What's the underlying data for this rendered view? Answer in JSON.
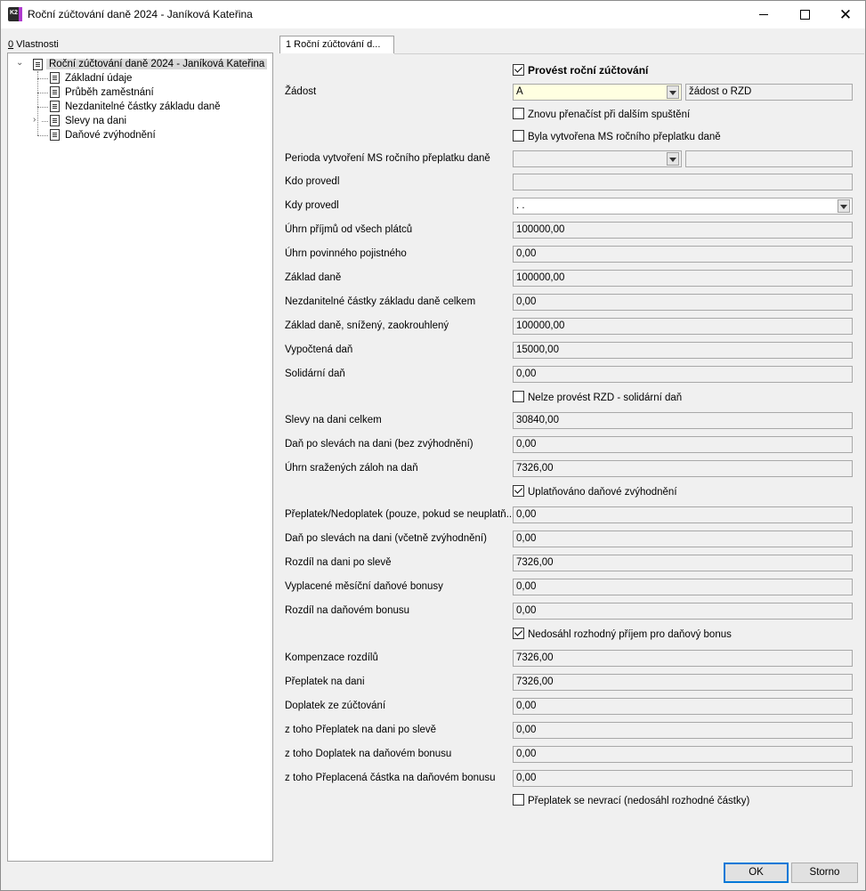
{
  "window": {
    "title": "Roční zúčtování daně 2024 - Janíková Kateřina",
    "icon_text": "K2"
  },
  "tree": {
    "header_prefix": "0",
    "header_rest": " Vlastnosti",
    "root": "Roční zúčtování daně 2024 - Janíková Kateřina",
    "items": [
      "Základní údaje",
      "Průběh zaměstnání",
      "Nezdanitelné částky základu daně",
      "Slevy na dani",
      "Daňové zvýhodnění"
    ]
  },
  "tab": {
    "label": "1 Roční zúčtování d..."
  },
  "form": {
    "chk_provest": "Provést roční zúčtování",
    "zadost_label": "Žádost",
    "zadost_value": "A",
    "zadost_desc": "žádost o RZD",
    "chk_znovu": "Znovu přenačíst při dalším spuštění",
    "chk_byla": "Byla vytvořena MS ročního přeplatku daně",
    "perioda_label": "Perioda vytvoření MS ročního přeplatku daně",
    "kdo_label": "Kdo provedl",
    "kdy_label": "Kdy provedl",
    "kdy_value": ". .",
    "uhrn_prijmu_label": "Úhrn příjmů od všech plátců",
    "uhrn_prijmu": "100000,00",
    "uhrn_poj_label": "Úhrn povinného pojistného",
    "uhrn_poj": "0,00",
    "zaklad_label": "Základ daně",
    "zaklad": "100000,00",
    "nezd_label": "Nezdanitelné částky základu daně celkem",
    "nezd": "0,00",
    "zaklad_sniz_label": "Základ daně, snížený, zaokrouhlený",
    "zaklad_sniz": "100000,00",
    "vypoctena_label": "Vypočtená daň",
    "vypoctena": "15000,00",
    "solidarni_label": "Solidární daň",
    "solidarni": "0,00",
    "chk_nelze": "Nelze provést RZD - solidární daň",
    "slevy_label": "Slevy na dani celkem",
    "slevy": "30840,00",
    "dan_po_bez_label": "Daň po slevách na dani (bez zvýhodnění)",
    "dan_po_bez": "0,00",
    "srazene_label": "Úhrn sražených záloh na daň",
    "srazene": "7326,00",
    "chk_uplatnovano": "Uplatňováno daňové zvýhodnění",
    "preplatek_nedo_label": "Přeplatek/Nedoplatek (pouze, pokud se neuplatň...",
    "preplatek_nedo": "0,00",
    "dan_po_vc_label": "Daň po slevách na dani (včetně zvýhodnění)",
    "dan_po_vc": "0,00",
    "rozdil_sleva_label": "Rozdíl na dani po slevě",
    "rozdil_sleva": "7326,00",
    "bonusy_label": "Vyplacené měsíční daňové bonusy",
    "bonusy": "0,00",
    "rozdil_bonus_label": "Rozdíl na daňovém bonusu",
    "rozdil_bonus": "0,00",
    "chk_nedosahl": "Nedosáhl rozhodný příjem pro daňový bonus",
    "kompenzace_label": "Kompenzace rozdílů",
    "kompenzace": "7326,00",
    "preplatek_label": "Přeplatek na dani",
    "preplatek": "7326,00",
    "doplatek_label": "Doplatek ze zúčtování",
    "doplatek": "0,00",
    "ztoho_prepl_label": "z toho Přeplatek na dani po slevě",
    "ztoho_prepl": "0,00",
    "ztoho_dopl_label": "z toho Doplatek na daňovém bonusu",
    "ztoho_dopl": "0,00",
    "ztoho_preplac_label": "z toho Přeplacená částka na daňovém bonusu",
    "ztoho_preplac": "0,00",
    "chk_nevraci": "Přeplatek se nevrací (nedosáhl rozhodné částky)"
  },
  "buttons": {
    "ok": "OK",
    "cancel": "Storno"
  }
}
